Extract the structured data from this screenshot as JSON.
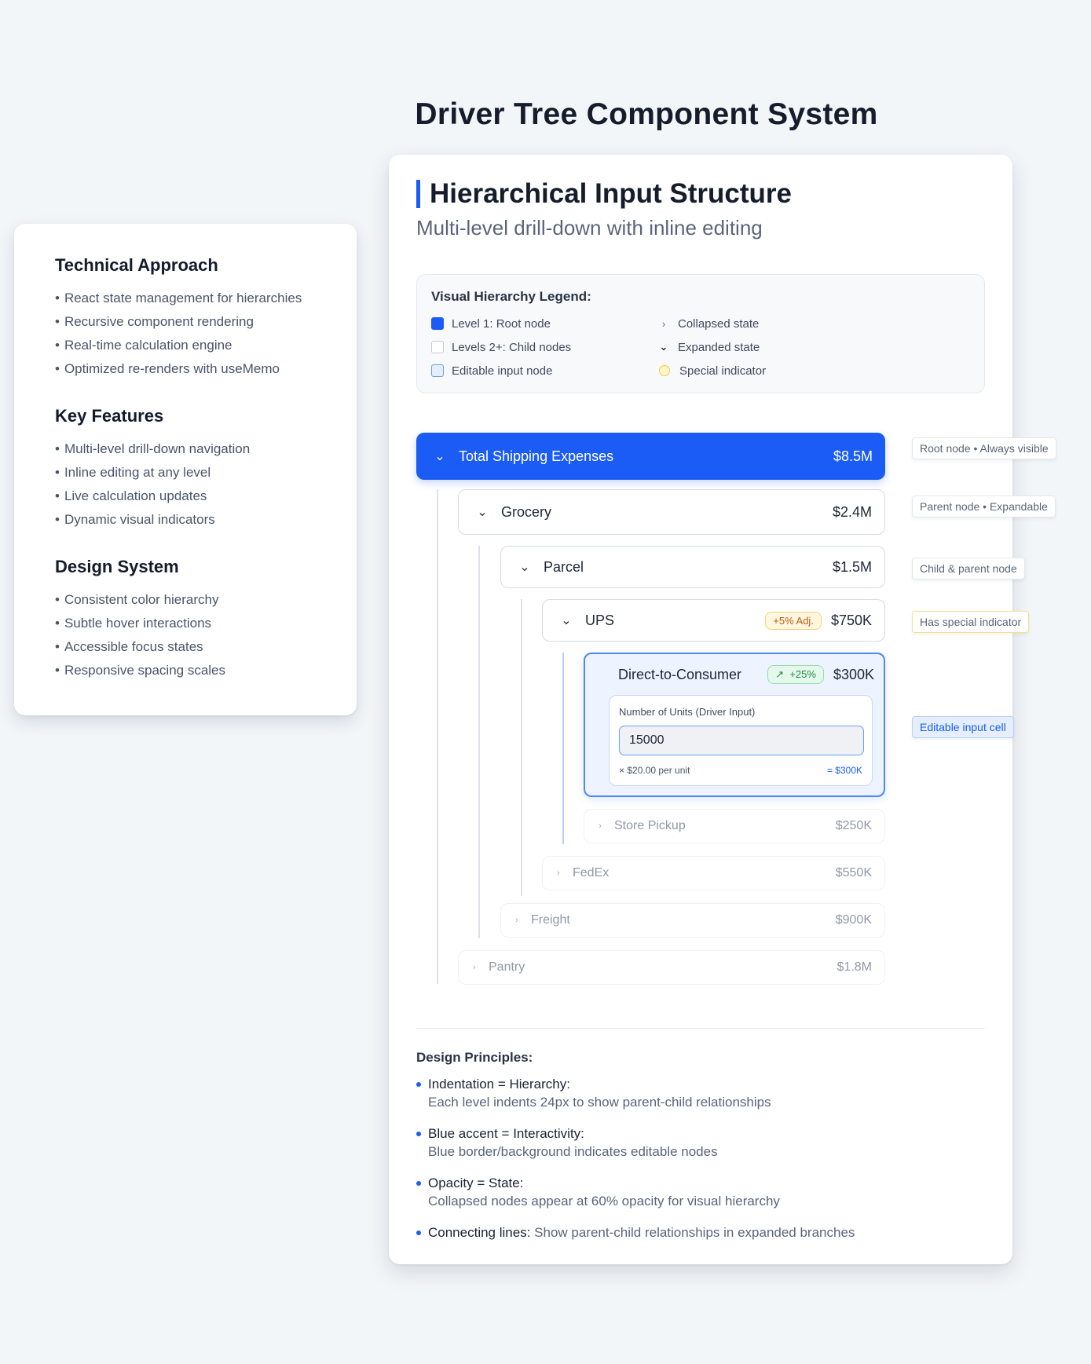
{
  "page_title": "Driver Tree Component System",
  "info_panel": {
    "sections": [
      {
        "title": "Technical Approach",
        "items": [
          "React state management for hierarchies",
          "Recursive component rendering",
          "Real-time calculation engine",
          "Optimized re-renders with useMemo"
        ]
      },
      {
        "title": "Key Features",
        "items": [
          "Multi-level drill-down navigation",
          "Inline editing at any level",
          "Live calculation updates",
          "Dynamic visual indicators"
        ]
      },
      {
        "title": "Design System",
        "items": [
          "Consistent color hierarchy",
          "Subtle hover interactions",
          "Accessible focus states",
          "Responsive spacing scales"
        ]
      }
    ]
  },
  "main": {
    "title": "Hierarchical Input Structure",
    "subtitle": "Multi-level drill-down with inline editing",
    "legend": {
      "title": "Visual Hierarchy Legend:",
      "items": [
        "Level 1: Root node",
        "Collapsed state",
        "Levels 2+: Child nodes",
        "Expanded state",
        "Editable input node",
        "Special indicator"
      ]
    },
    "tree": {
      "root": {
        "label": "Total Shipping Expenses",
        "value": "$8.5M"
      },
      "grocery": {
        "label": "Grocery",
        "value": "$2.4M"
      },
      "parcel": {
        "label": "Parcel",
        "value": "$1.5M"
      },
      "ups": {
        "label": "UPS",
        "value": "$750K",
        "badge": "+5% Adj."
      },
      "dtc": {
        "label": "Direct-to-Consumer",
        "value": "$300K",
        "badge": "+25%",
        "input_caption": "Number of Units (Driver Input)",
        "input_value": "15000",
        "unit_price": "× $20.00 per unit",
        "result": "= $300K"
      },
      "store_pickup": {
        "label": "Store Pickup",
        "value": "$250K"
      },
      "fedex": {
        "label": "FedEx",
        "value": "$550K"
      },
      "freight": {
        "label": "Freight",
        "value": "$900K"
      },
      "pantry": {
        "label": "Pantry",
        "value": "$1.8M"
      }
    },
    "annotations": [
      "Root node • Always visible",
      "Parent node • Expandable",
      "Child & parent node",
      "Has special indicator",
      "Editable input cell"
    ],
    "principles": {
      "title": "Design Principles:",
      "items": [
        {
          "head": "Indentation = Hierarchy:",
          "desc": "Each level indents 24px to show parent-child relationships"
        },
        {
          "head": "Blue accent = Interactivity:",
          "desc": "Blue border/background indicates editable nodes"
        },
        {
          "head": "Opacity = State:",
          "desc": "Collapsed nodes appear at 60% opacity for visual hierarchy"
        },
        {
          "head": "Connecting lines:",
          "desc": "Show parent-child relationships in expanded branches"
        }
      ]
    }
  },
  "colors": {
    "accent": "#1a5cf5",
    "background": "#f3f6f9",
    "indicator": "#f2c94c",
    "positive": "#1a8a45"
  }
}
